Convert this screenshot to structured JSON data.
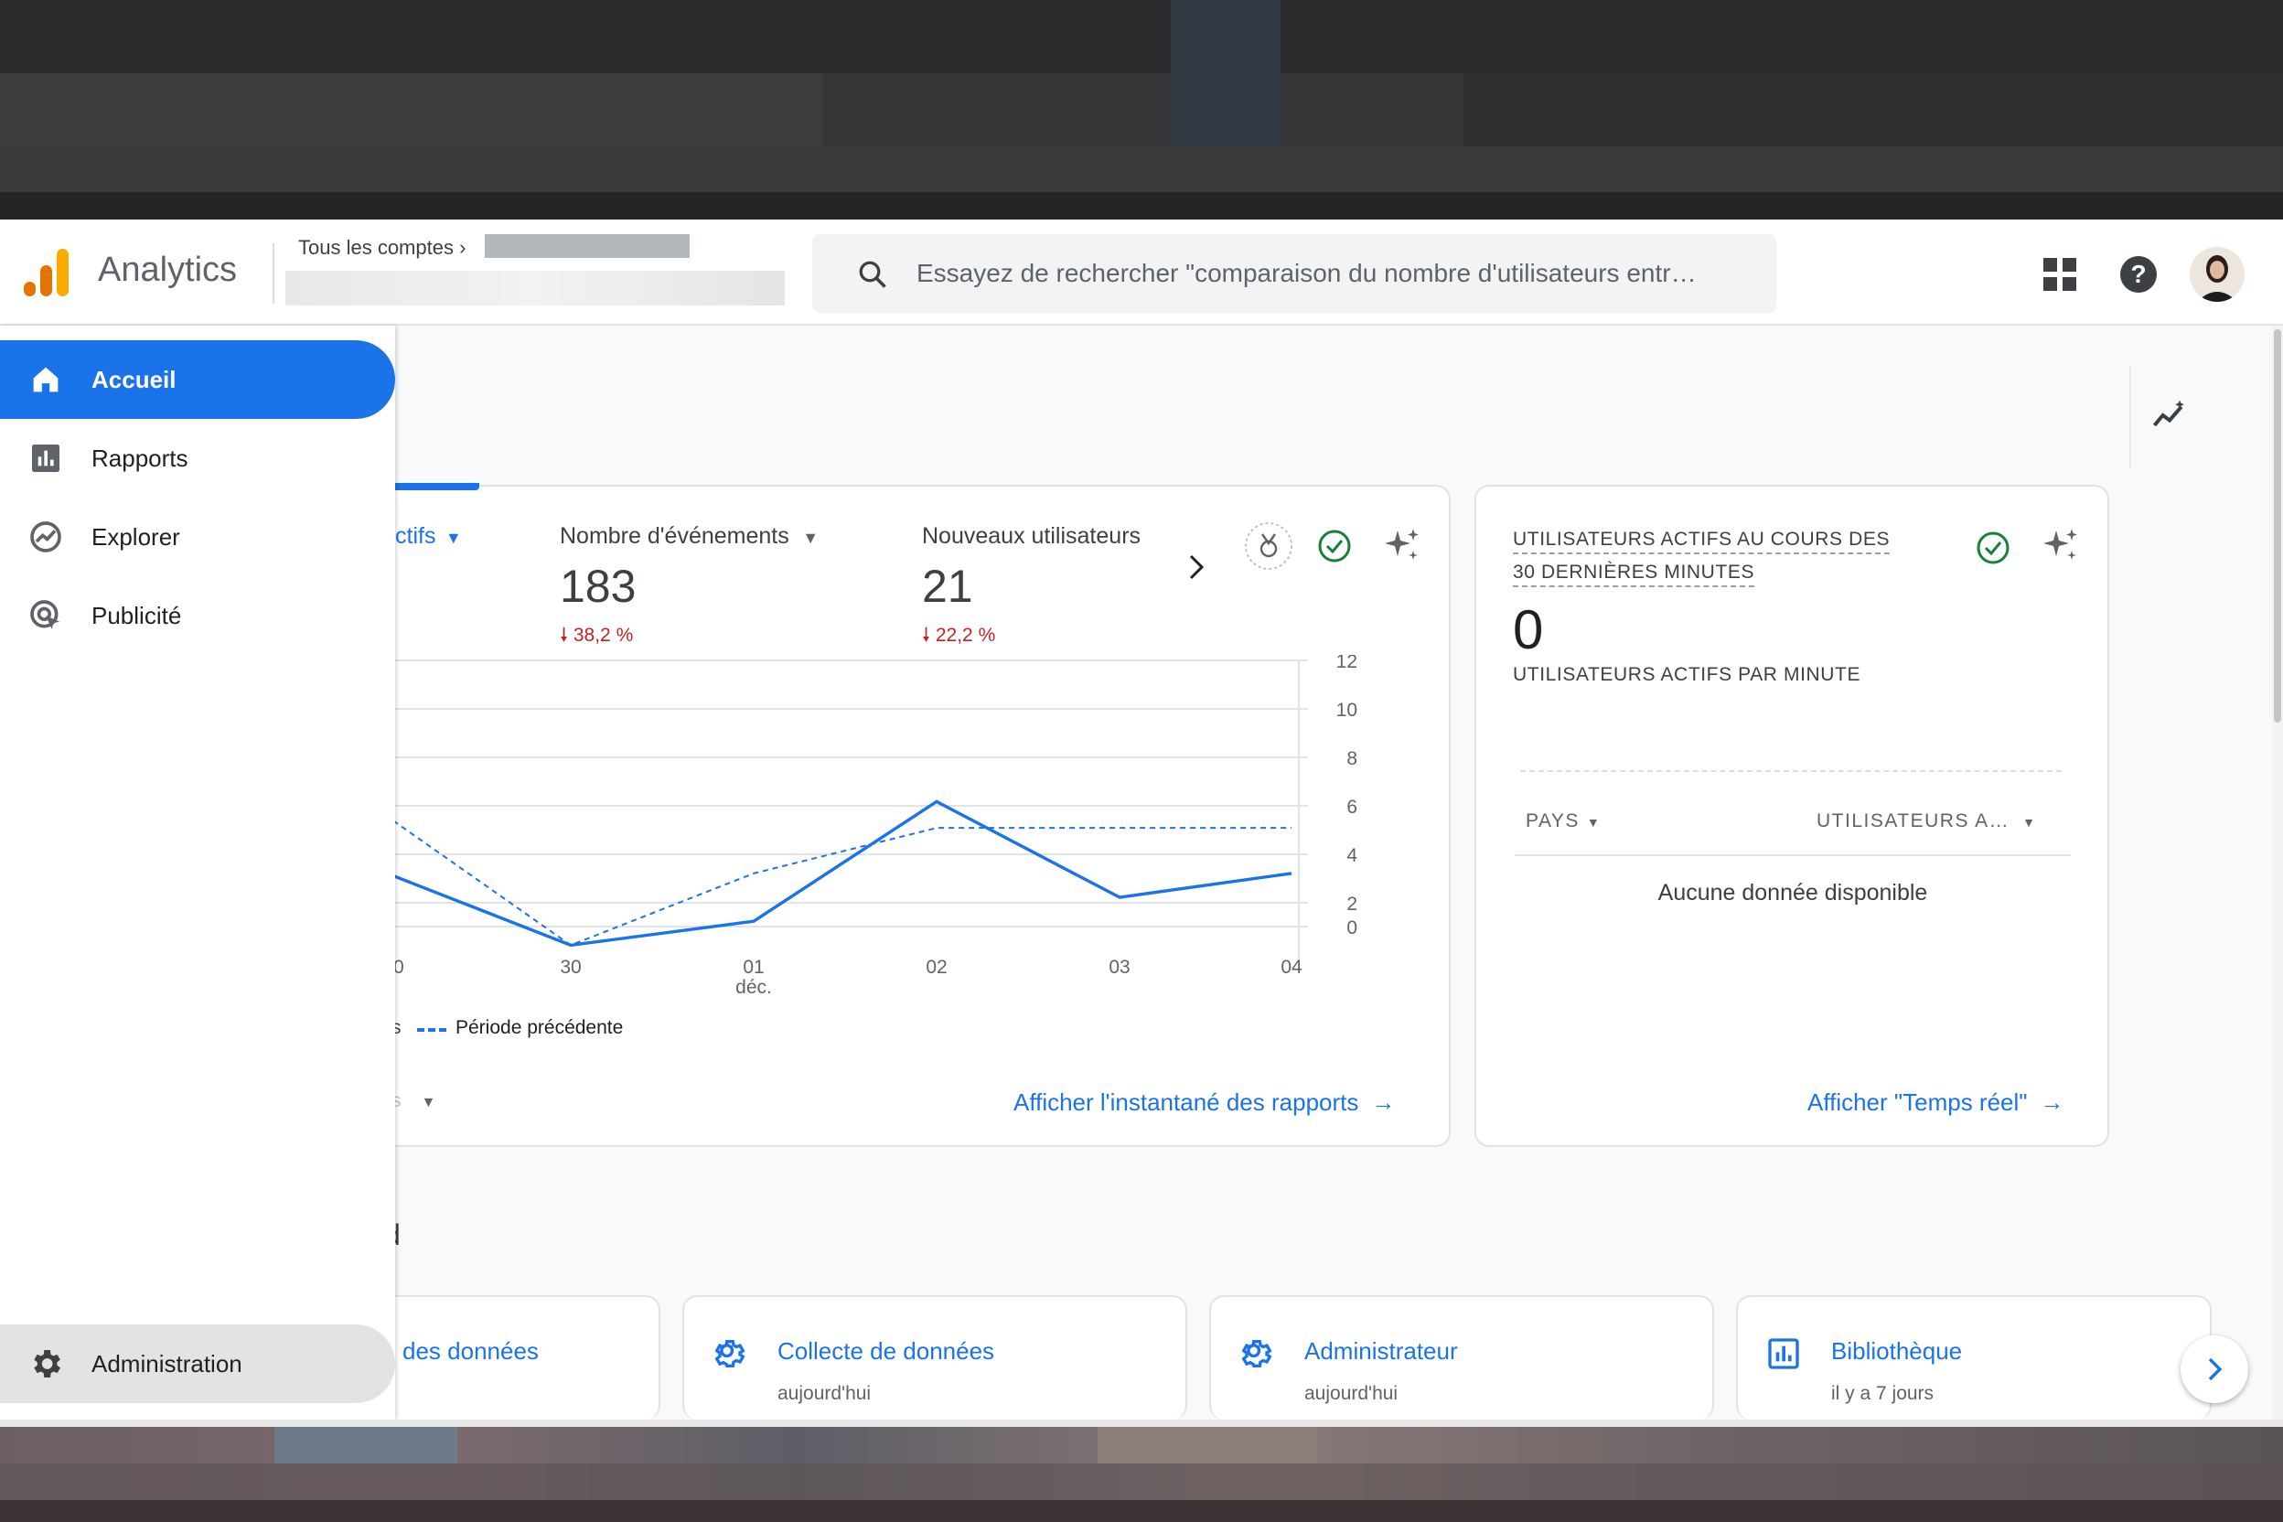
{
  "header": {
    "brand": "Analytics",
    "breadcrumb": "Tous les comptes",
    "search_placeholder": "Essayez de rechercher \"comparaison du nombre d'utilisateurs entr…"
  },
  "sidebar": {
    "items": [
      {
        "label": "Accueil",
        "icon": "home-icon"
      },
      {
        "label": "Rapports",
        "icon": "reports-icon"
      },
      {
        "label": "Explorer",
        "icon": "explore-icon"
      },
      {
        "label": "Publicité",
        "icon": "advertising-icon"
      }
    ],
    "admin_label": "Administration"
  },
  "overview": {
    "metrics": [
      {
        "label": "ctifs",
        "value": "",
        "change": ""
      },
      {
        "label": "Nombre d'événements",
        "value": "183",
        "change": "38,2 %"
      },
      {
        "label": "Nouveaux utilisateurs",
        "value": "21",
        "change": "22,2 %"
      }
    ],
    "legend_current": "s",
    "legend_previous": "Période précédente",
    "period_select": "s",
    "link": "Afficher l'instantané des rapports",
    "colors": {
      "accent": "#1a73e8",
      "negative": "#c5221f",
      "success": "#188038"
    }
  },
  "chart_data": {
    "type": "line",
    "x": [
      "0",
      "30",
      "01",
      "02",
      "03",
      "04"
    ],
    "x_sublabels": [
      "",
      "",
      "déc.",
      "",
      "",
      ""
    ],
    "yticks": [
      "12",
      "10",
      "8",
      "6",
      "4",
      "2",
      "0"
    ],
    "ylim": [
      0,
      12
    ],
    "grid": true,
    "series": [
      {
        "name": "",
        "style": "solid",
        "values": [
          3.0,
          0.1,
          1.1,
          6.1,
          2.1,
          3.1
        ]
      },
      {
        "name": "Période précédente",
        "style": "dashed",
        "values": [
          5.3,
          0.1,
          3.1,
          5.0,
          5.0,
          5.0
        ]
      }
    ]
  },
  "realtime": {
    "title_line1": "UTILISATEURS ACTIFS AU COURS DES",
    "title_line2": "30 DERNIÈRES MINUTES",
    "value": "0",
    "subtitle": "UTILISATEURS ACTIFS PAR MINUTE",
    "col_country": "PAYS",
    "col_users": "UTILISATEURS A…",
    "empty": "Aucune donnée disponible",
    "link": "Afficher \"Temps réel\""
  },
  "recent": {
    "title": "d",
    "cards": [
      {
        "title": "des données",
        "sub": ""
      },
      {
        "title": "Collecte de données",
        "sub": "aujourd'hui",
        "icon": "gear-icon"
      },
      {
        "title": "Administrateur",
        "sub": "aujourd'hui",
        "icon": "gear-icon"
      },
      {
        "title": "Bibliothèque",
        "sub": "il y a 7 jours",
        "icon": "library-icon"
      }
    ]
  }
}
